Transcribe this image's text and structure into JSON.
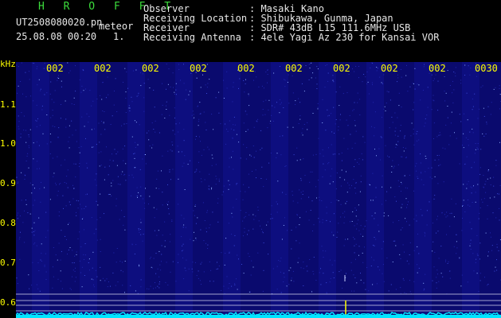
{
  "header": {
    "station_code": "H R O F F T",
    "filename": "UT2508080020.pn",
    "tag": "meteor",
    "datetime": "25.08.08 00:20",
    "count": "1.",
    "info": [
      {
        "label": "Observer",
        "value": ": Masaki Kano"
      },
      {
        "label": "Receiving Location",
        "value": ": Shibukawa, Gunma, Japan"
      },
      {
        "label": "Receiver",
        "value": ": SDR# 43dB L15 111.6MHz USB"
      },
      {
        "label": "Receiving Antenna",
        "value": ": 4ele Yagi Az 230 for Kansai VOR"
      }
    ]
  },
  "axis": {
    "y_unit": "kHz",
    "y_labels": [
      "1.1",
      "1.0",
      "0.9",
      "0.8",
      "0.7",
      "0.6"
    ],
    "x_labels": [
      "002",
      "002",
      "002",
      "002",
      "002",
      "002",
      "002",
      "002",
      "002",
      "0030"
    ]
  },
  "colors": {
    "background": "#000000",
    "spectrogram": "#0a0a6e",
    "axis_text": "#ffff00",
    "trace": "#00e5ff",
    "header_green": "#3cdc3c"
  }
}
